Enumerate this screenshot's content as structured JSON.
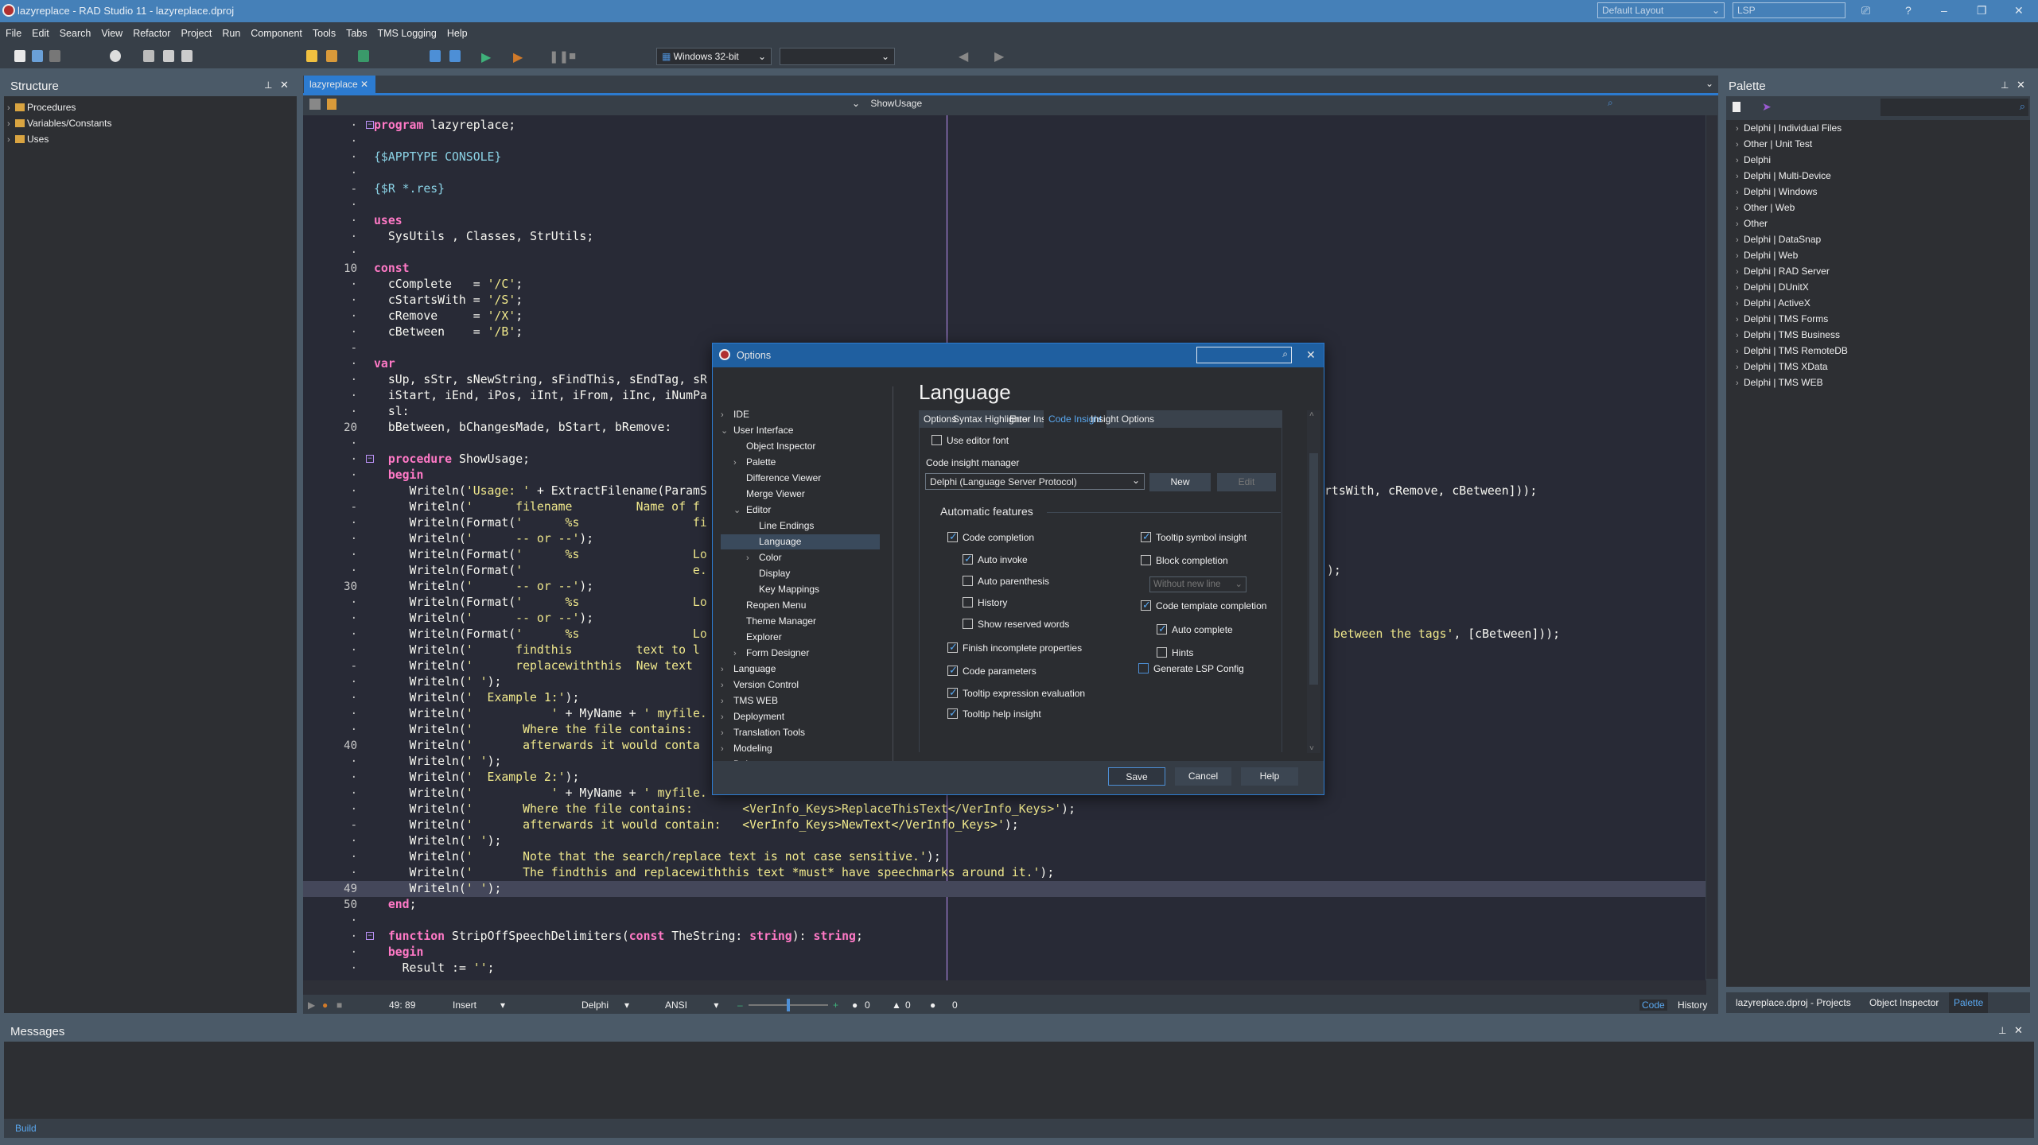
{
  "window": {
    "title": "lazyreplace - RAD Studio 11 - lazyreplace.dproj",
    "layout": "Default Layout",
    "search": "LSP",
    "help": "?",
    "minimize": "–",
    "restore": "❐",
    "close": "✕"
  },
  "menu": [
    "File",
    "Edit",
    "Search",
    "View",
    "Refactor",
    "Project",
    "Run",
    "Component",
    "Tools",
    "Tabs",
    "TMS Logging",
    "Help"
  ],
  "toolbar": {
    "platform": "Windows 32-bit",
    "config": ""
  },
  "structure": {
    "title": "Structure",
    "items": [
      "Procedures",
      "Variables/Constants",
      "Uses"
    ]
  },
  "editor": {
    "tab": "lazyreplace",
    "method_combo": "ShowUsage",
    "current_line": 49,
    "lines": [
      "program lazyreplace;",
      "",
      "{$APPTYPE CONSOLE}",
      "",
      "{$R *.res}",
      "",
      "uses",
      "  SysUtils , Classes, StrUtils;",
      "",
      "const",
      "  cComplete   = '/C';",
      "  cStartsWith = '/S';",
      "  cRemove     = '/X';",
      "  cBetween    = '/B';",
      "",
      "var",
      "  sUp, sStr, sNewString, sFindThis, sEndTag, sR",
      "  iStart, iEnd, iPos, iInt, iFrom, iInc, iNumPa",
      "  sl:",
      "  bBetween, bChangesMade, bStart, bRemove:",
      "",
      "  procedure ShowUsage;",
      "  begin",
      "     Writeln('Usage: ' + ExtractFilename(ParamS",
      "     Writeln('      filename         Name of f",
      "     Writeln(Format('      %s                fi",
      "     Writeln('      -- or --');",
      "     Writeln(Format('      %s                Lo",
      "     Writeln(Format('                        e.",
      "     Writeln('      -- or --');",
      "     Writeln(Format('      %s                Lo",
      "     Writeln('      -- or --');",
      "     Writeln(Format('      %s                Lo",
      "     Writeln('      findthis         text to l",
      "     Writeln('      replacewiththis  New text",
      "     Writeln(' ');",
      "     Writeln('  Example 1:');",
      "     Writeln('           ' + MyName + ' myfile.",
      "     Writeln('       Where the file contains:",
      "     Writeln('       afterwards it would conta",
      "     Writeln(' ');",
      "     Writeln('  Example 2:');",
      "     Writeln('           ' + MyName + ' myfile.",
      "     Writeln('       Where the file contains:       <VerInfo_Keys>ReplaceThisText</VerInfo_Keys>');",
      "     Writeln('       afterwards it would contain:   <VerInfo_Keys>NewText</VerInfo_Keys>');",
      "     Writeln(' ');",
      "     Writeln('       Note that the search/replace text is not case sensitive.');",
      "     Writeln('       The findthis and replacewiththis text *must* have speechmarks around it.');",
      "     Writeln(' ');",
      "  end;",
      "",
      "  function StripOffSpeechDelimiters(const TheString: string): string;",
      "  begin",
      "    Result := '';"
    ],
    "right_fragments": {
      "line24": "rtsWith, cRemove, cBetween]));",
      "line29": ");",
      "line33_string": "between the tags'",
      "line33_rest": ", [cBetween]));"
    },
    "status": {
      "position": "49: 89",
      "mode": "Insert",
      "language": "Delphi",
      "encoding": "ANSI",
      "errors": "0",
      "warnings": "0",
      "hints": "0",
      "zoom_percent": 50
    },
    "view_tabs": [
      "Code",
      "History"
    ]
  },
  "palette": {
    "title": "Palette",
    "items": [
      "Delphi | Individual Files",
      "Other | Unit Test",
      "Delphi",
      "Delphi | Multi-Device",
      "Delphi | Windows",
      "Other | Web",
      "Other",
      "Delphi | DataSnap",
      "Delphi | Web",
      "Delphi | RAD Server",
      "Delphi | DUnitX",
      "Delphi | ActiveX",
      "Delphi | TMS Forms",
      "Delphi | TMS Business",
      "Delphi | TMS RemoteDB",
      "Delphi | TMS XData",
      "Delphi | TMS WEB"
    ],
    "bottom_tabs": [
      "lazyreplace.dproj - Projects",
      "Object Inspector",
      "Palette"
    ],
    "active_tab": "Palette"
  },
  "messages": {
    "title": "Messages",
    "tab": "Build"
  },
  "dialog": {
    "title": "Options",
    "heading": "Language",
    "tree": [
      {
        "label": "IDE",
        "level": 0,
        "chevron": "right"
      },
      {
        "label": "User Interface",
        "level": 0,
        "chevron": "down"
      },
      {
        "label": "Object Inspector",
        "level": 1
      },
      {
        "label": "Palette",
        "level": 1,
        "chevron": "right"
      },
      {
        "label": "Difference Viewer",
        "level": 1
      },
      {
        "label": "Merge Viewer",
        "level": 1
      },
      {
        "label": "Editor",
        "level": 1,
        "chevron": "down"
      },
      {
        "label": "Line Endings",
        "level": 2
      },
      {
        "label": "Language",
        "level": 2,
        "selected": true
      },
      {
        "label": "Color",
        "level": 2,
        "chevron": "right"
      },
      {
        "label": "Display",
        "level": 2
      },
      {
        "label": "Key Mappings",
        "level": 2
      },
      {
        "label": "Reopen Menu",
        "level": 1
      },
      {
        "label": "Theme Manager",
        "level": 1
      },
      {
        "label": "Explorer",
        "level": 1
      },
      {
        "label": "Form Designer",
        "level": 1,
        "chevron": "right"
      },
      {
        "label": "Language",
        "level": 0,
        "chevron": "right"
      },
      {
        "label": "Version Control",
        "level": 0,
        "chevron": "right"
      },
      {
        "label": "TMS WEB",
        "level": 0,
        "chevron": "right"
      },
      {
        "label": "Deployment",
        "level": 0,
        "chevron": "right"
      },
      {
        "label": "Translation Tools",
        "level": 0,
        "chevron": "right"
      },
      {
        "label": "Modeling",
        "level": 0,
        "chevron": "right"
      },
      {
        "label": "Debugger",
        "level": 0,
        "chevron": "right"
      }
    ],
    "tabs": [
      "Options",
      "Syntax Highlighter",
      "Error Insight",
      "Code Insight",
      "Insight Options"
    ],
    "active_tab": "Code Insight",
    "use_editor_font": {
      "label": "Use editor font",
      "checked": false
    },
    "manager_label": "Code insight manager",
    "manager_value": "Delphi (Language Server Protocol)",
    "new_button": "New",
    "edit_button": "Edit",
    "group_label": "Automatic features",
    "left_checks": [
      {
        "label": "Code completion",
        "checked": true,
        "indent": false
      },
      {
        "label": "Auto invoke",
        "checked": true,
        "indent": true
      },
      {
        "label": "Auto parenthesis",
        "checked": false,
        "indent": true
      },
      {
        "label": "History",
        "checked": false,
        "indent": true
      },
      {
        "label": "Show reserved words",
        "checked": false,
        "indent": true
      },
      {
        "label": "Finish incomplete properties",
        "checked": true,
        "indent": false
      },
      {
        "label": "Code parameters",
        "checked": true,
        "indent": false
      },
      {
        "label": "Tooltip expression evaluation",
        "checked": true,
        "indent": false
      },
      {
        "label": "Tooltip help insight",
        "checked": true,
        "indent": false
      }
    ],
    "right_checks": {
      "tooltip_symbol": {
        "label": "Tooltip symbol insight",
        "checked": true
      },
      "block_completion": {
        "label": "Block completion",
        "checked": false
      },
      "block_mode": "Without new line",
      "code_template": {
        "label": "Code template completion",
        "checked": true
      },
      "auto_complete": {
        "label": "Auto complete",
        "checked": true
      },
      "hints": {
        "label": "Hints",
        "checked": false
      },
      "generate_lsp": {
        "label": "Generate LSP Config",
        "checked": false
      }
    },
    "save": "Save",
    "cancel": "Cancel",
    "help": "Help"
  },
  "colors": {
    "accent": "#2c7bd0",
    "keyword": "#ff79c6",
    "string": "#f1e98c",
    "directive": "#8bd3e6",
    "editor_bg": "#282a36"
  }
}
